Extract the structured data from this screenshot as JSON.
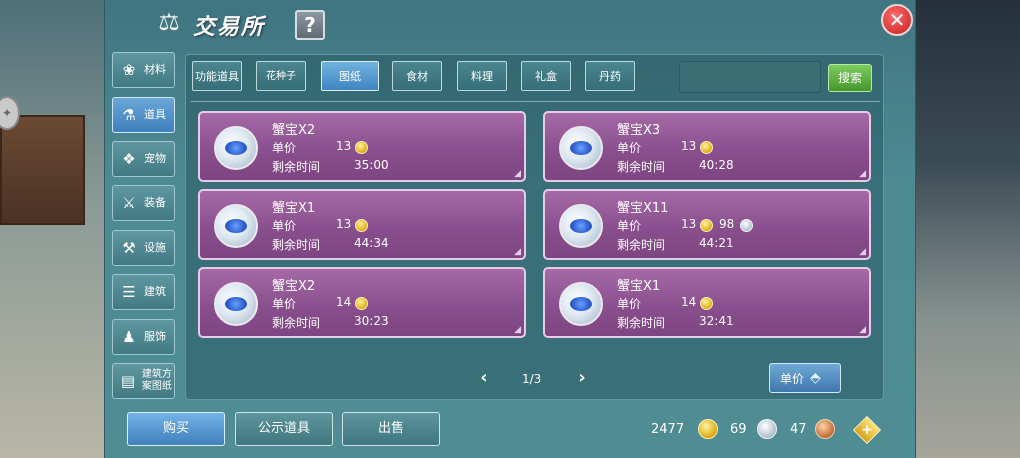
{
  "window": {
    "title": "交易所",
    "help_label": "?",
    "close_label": "✕"
  },
  "categories": [
    {
      "label": "材料",
      "icon": "materials-icon",
      "glyph": "❀"
    },
    {
      "label": "道具",
      "icon": "props-icon",
      "glyph": "⚗"
    },
    {
      "label": "宠物",
      "icon": "pet-paw-icon",
      "glyph": "❖"
    },
    {
      "label": "装备",
      "icon": "sword-icon",
      "glyph": "⚔"
    },
    {
      "label": "设施",
      "icon": "facility-icon",
      "glyph": "⚒"
    },
    {
      "label": "建筑",
      "icon": "building-icon",
      "glyph": "☰"
    },
    {
      "label": "服饰",
      "icon": "clothing-icon",
      "glyph": "♟"
    },
    {
      "label": "建筑方案图纸",
      "icon": "blueprint-icon",
      "glyph": "▤"
    }
  ],
  "active_category": "道具",
  "subtabs": [
    {
      "label": "功能道具"
    },
    {
      "label": "花种子"
    },
    {
      "label": "图纸"
    },
    {
      "label": "食材"
    },
    {
      "label": "料理"
    },
    {
      "label": "礼盒"
    },
    {
      "label": "丹药"
    }
  ],
  "active_subtab": "图纸",
  "search": {
    "placeholder": "",
    "button_label": "搜索"
  },
  "labels": {
    "unit_price": "单价",
    "time_left": "剩余时间"
  },
  "items": [
    {
      "name": "蟹宝X2",
      "price_gold": "13",
      "time": "35:00"
    },
    {
      "name": "蟹宝X3",
      "price_gold": "13",
      "time": "40:28"
    },
    {
      "name": "蟹宝X1",
      "price_gold": "13",
      "time": "44:34"
    },
    {
      "name": "蟹宝X11",
      "price_gold": "13",
      "price_silver": "98",
      "time": "44:21"
    },
    {
      "name": "蟹宝X2",
      "price_gold": "14",
      "time": "30:23"
    },
    {
      "name": "蟹宝X1",
      "price_gold": "14",
      "time": "32:41"
    }
  ],
  "pager": {
    "text": "1/3",
    "prev": "‹",
    "next": "›"
  },
  "sort": {
    "label": "单价",
    "icon": "sort-diamond-icon"
  },
  "actions": {
    "buy": "购买",
    "public": "公示道具",
    "sell": "出售"
  },
  "currency": {
    "gold": "2477",
    "silver": "69",
    "copper": "47"
  },
  "colors": {
    "card": "#8a4f8e",
    "panel": "#4d8a92",
    "buy": "#3f7fbd",
    "search": "#46962e"
  }
}
